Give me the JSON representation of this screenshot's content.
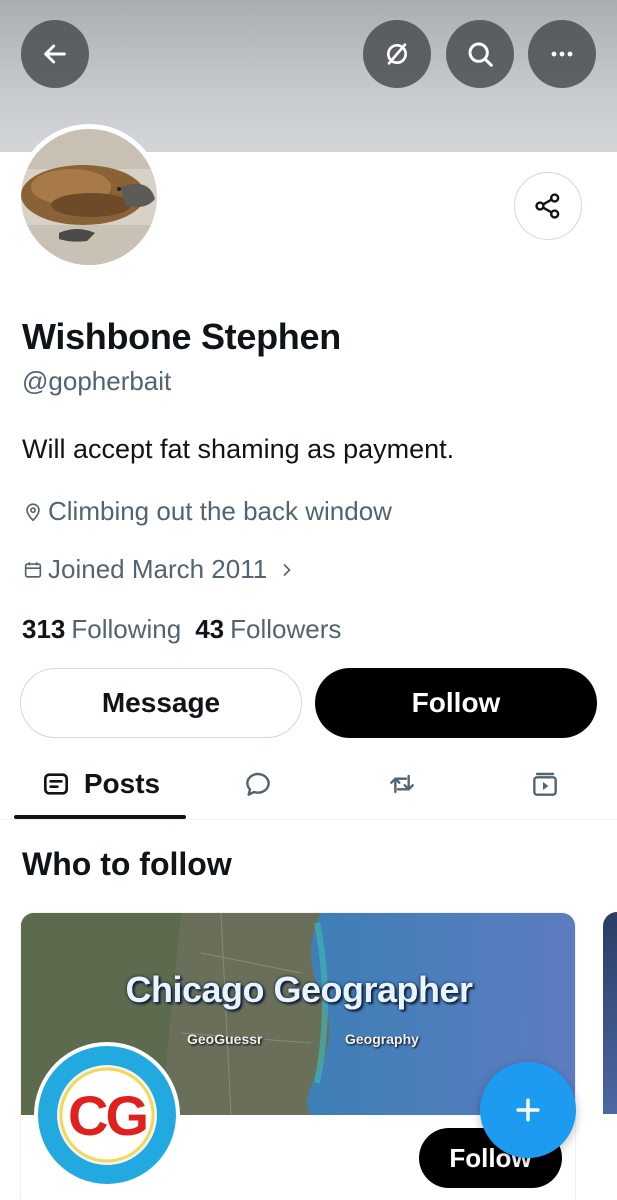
{
  "header": {
    "back_icon": "arrow-left-icon",
    "actions": [
      "no-notifications-icon",
      "search-icon",
      "more-icon"
    ]
  },
  "profile": {
    "name": "Wishbone Stephen",
    "handle": "@gopherbait",
    "bio": "Will accept fat shaming as payment.",
    "location": "Climbing out the back window",
    "joined": "Joined March 2011",
    "following_count": "313",
    "following_label": "Following",
    "followers_count": "43",
    "followers_label": "Followers"
  },
  "actions": {
    "message_label": "Message",
    "follow_label": "Follow"
  },
  "tabs": {
    "posts_label": "Posts",
    "icons": [
      "posts-icon",
      "replies-icon",
      "reposts-icon",
      "media-icon"
    ]
  },
  "who_to_follow": {
    "title": "Who to follow",
    "card": {
      "banner_title": "Chicago Geographer",
      "banner_left_tag": "GeoGuessr",
      "banner_right_tag": "Geography",
      "avatar_text": "CG",
      "follow_label": "Follow"
    }
  },
  "colors": {
    "accent": "#1d9bf0",
    "text": "#0f1419",
    "secondary": "#536471"
  }
}
